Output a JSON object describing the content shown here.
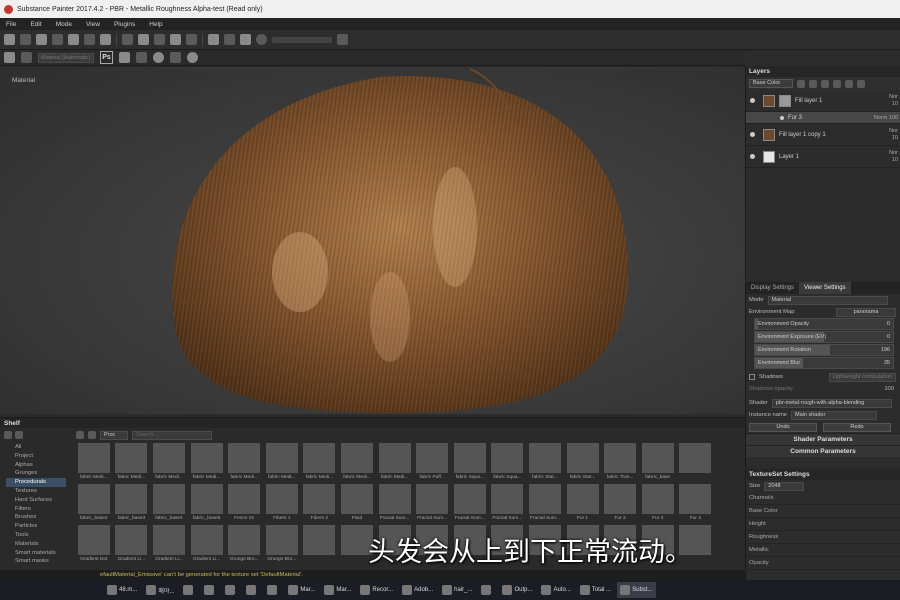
{
  "window": {
    "title": "Substance Painter 2017.4.2 - PBR - Metallic Roughness Alpha-test (Read only)"
  },
  "menu": [
    "File",
    "Edit",
    "Mode",
    "View",
    "Plugins",
    "Help"
  ],
  "toolbar2": {
    "field_placeholder": "Material (Automatic)",
    "ps_label": "Ps"
  },
  "viewport": {
    "label": "Material"
  },
  "layers": {
    "title": "Layers",
    "channel_select": "Base Color",
    "items": [
      {
        "name": "Fill layer 1",
        "blend": "Nor",
        "opacity": "10"
      },
      {
        "name": "Fur 3",
        "blend": "Norm",
        "opacity": "100"
      },
      {
        "name": "Fill layer 1 copy 1",
        "blend": "Nor",
        "opacity": "10"
      },
      {
        "name": "Layer 1",
        "blend": "Nor",
        "opacity": "10"
      }
    ]
  },
  "settings": {
    "tabs": [
      "Display Settings",
      "Viewer Settings"
    ],
    "mode_label": "Mode",
    "mode_value": "Material",
    "env_map_label": "Environment Map",
    "env_map_value": "panorama",
    "sliders": [
      {
        "label": "Environment Opacity",
        "value": "0",
        "fill": 0.02
      },
      {
        "label": "Environment Exposure (EV)",
        "value": "0",
        "fill": 0.5
      },
      {
        "label": "Environment Rotation",
        "value": "196",
        "fill": 0.54
      },
      {
        "label": "Environment Blur",
        "value": "35",
        "fill": 0.35
      }
    ],
    "shadows_label": "Shadows",
    "shadows_button": "Lightweight computation",
    "shadows_opacity_label": "Shadows opacity",
    "shadows_opacity_value": "100",
    "shader_label": "Shader",
    "shader_value": "pbr-metal-rough-with-alpha-blending",
    "instance_label": "Instance name",
    "instance_value": "Main shader",
    "undo_label": "Undo",
    "redo_label": "Redo",
    "shader_params": "Shader Parameters",
    "common_params": "Common Parameters"
  },
  "texset": {
    "title": "TextureSet Settings",
    "size_label": "Size",
    "size_value": "2048",
    "channels": [
      "Channels",
      "Base Color",
      "Height",
      "Roughness",
      "Metallic",
      "Opacity"
    ]
  },
  "shelf": {
    "title": "Shelf",
    "filter_value": "Proc",
    "search_placeholder": "Search...",
    "categories": [
      "All",
      "Project",
      "Alphas",
      "Grunges",
      "Procedurals",
      "Textures",
      "Hard Surfaces",
      "Filters",
      "Brushes",
      "Particles",
      "Tools",
      "Materials",
      "Smart materials",
      "Smart masks"
    ],
    "selected_category": 4,
    "tiles": [
      "fabric Medi...",
      "fabric Medi...",
      "fabric Medi...",
      "fabric Medi...",
      "fabric Medi...",
      "fabric Medi...",
      "fabric Medi...",
      "fabric Medi...",
      "fabric Medi...",
      "fabric Puff...",
      "fabric Squa...",
      "fabric Squa...",
      "fabric Star...",
      "fabric Star...",
      "fabric Tran...",
      "fabric_base",
      "",
      "fabric_base2",
      "fabric_base3",
      "fabric_base4",
      "fabric_base5",
      "Fence 01",
      "Fibers 1",
      "Fibers 2",
      "Fluid",
      "Fractal Sum...",
      "Fractal Sum...",
      "Fractal Sum...",
      "Fractal Sum...",
      "Fractal Sum...",
      "Fur 1",
      "Fur 2",
      "Fur 3",
      "Fur 4",
      "Gradient Dot",
      "Gradient Li...",
      "Gradient Li...",
      "Gradient Li...",
      "Grunge Bro...",
      "Grunge Bru...",
      "",
      "",
      "",
      "",
      "",
      "",
      "",
      "",
      "",
      "",
      ""
    ]
  },
  "status": {
    "message": "efaultMaterial_Emissive' can't be generated for the texture set 'DefaultMaterial'."
  },
  "subtitle": "头发会从上到下正常流动。",
  "taskbar": [
    "48.m...",
    "매야...",
    "",
    "",
    "",
    "",
    "",
    "Mar...",
    "Mar...",
    "Recor...",
    "Adob...",
    "hair_...",
    "",
    "Outp...",
    "Auto...",
    "Total ...",
    "Subst..."
  ]
}
